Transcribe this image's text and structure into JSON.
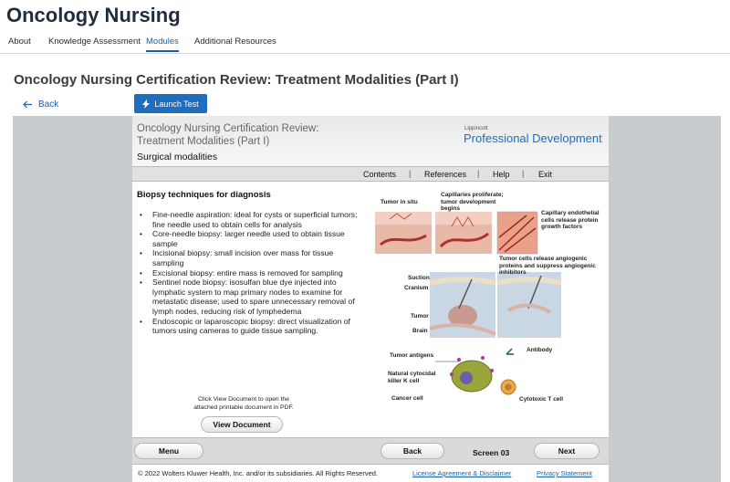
{
  "app": {
    "title": "Oncology Nursing"
  },
  "tabs": [
    {
      "label": "About",
      "active": false
    },
    {
      "label": "Knowledge Assessment",
      "active": false
    },
    {
      "label": "Modules",
      "active": true
    },
    {
      "label": "Additional Resources",
      "active": false
    }
  ],
  "page": {
    "title": "Oncology Nursing Certification Review: Treatment Modalities (Part I)",
    "back_label": "Back",
    "launch_label": "Launch Test"
  },
  "module": {
    "title": "Oncology Nursing Certification Review: Treatment Modalities (Part I)",
    "subtitle": "Surgical modalities",
    "brand_small": "Lippincott",
    "brand_big": "Professional Development",
    "nav": [
      "Contents",
      "References",
      "Help",
      "Exit"
    ],
    "heading": "Biopsy techniques for diagnosis",
    "bullets": [
      "Fine-needle aspiration: ideal for cysts or superficial tumors; fine needle used to obtain cells for analysis",
      "Core-needle biopsy: larger needle used to obtain tissue sample",
      "Incisional biopsy: small incision over mass for tissue sampling",
      "Excisional biopsy: entire mass is removed for sampling",
      "Sentinel node biopsy: isosulfan blue dye injected into lymphatic system to map primary nodes to examine for metastatic disease; used to spare unnecessary removal of lymph nodes, reducing risk of lymphedema",
      "Endoscopic or laparoscopic biopsy: direct visualization of tumors using cameras to guide tissue sampling."
    ],
    "view_note": "Click View Document to open the attached printable document in PDF.",
    "view_doc_label": "View Document",
    "figure_labels": {
      "tumor_in_situ": "Tumor in situ",
      "capillaries": "Capillaries proliferate; tumor development begins",
      "capillary_release": "Capillary endothelial cells release protein growth factors",
      "tumor_cells_release": "Tumor cells release angiogenic proteins and suppress angiogenic inhibitors",
      "suction": "Suction",
      "cranium": "Cranium",
      "tumor": "Tumor",
      "brain": "Brain",
      "tumor_antigens": "Tumor antigens",
      "antibody": "Antibody",
      "nk_cell": "Natural cytocidal killer K cell",
      "cancer_cell": "Cancer cell",
      "cytotoxic": "Cytotoxic T cell"
    },
    "footer": {
      "menu_label": "Menu",
      "back_label": "Back",
      "screen_label": "Screen 03",
      "next_label": "Next"
    },
    "copyright": "© 2022 Wolters Kluwer Health, Inc. and/or its subsidiaries. All Rights Reserved.",
    "license_link": "License Agreement & Disclaimer",
    "privacy_link": "Privacy Statement"
  },
  "colors": {
    "accent": "#1f6dbf",
    "link": "#1f5fa8",
    "viewer_bg": "#c9ccce"
  },
  "icons": {
    "back": "arrow-left-icon",
    "launch": "lightning-icon"
  }
}
